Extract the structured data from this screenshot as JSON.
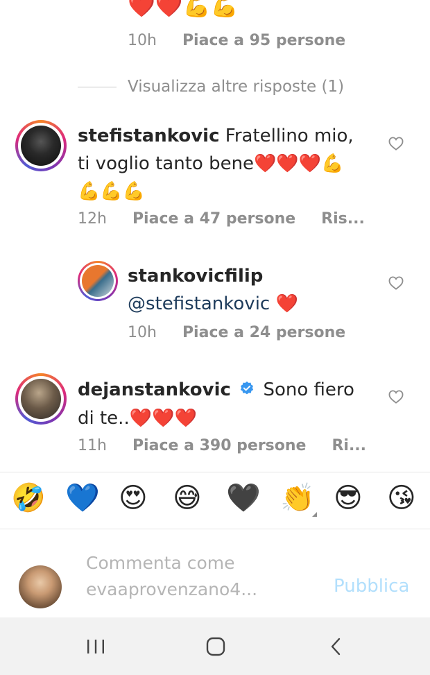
{
  "top_partial": {
    "emojis": "❤️❤️💪💪",
    "time": "10h",
    "likes": "Piace a 95 persone"
  },
  "view_more_replies": "Visualizza altre risposte (1)",
  "comments": [
    {
      "username": "stefistankovic",
      "text_line1": "Fratellino mio,",
      "text_line2": "ti voglio tanto bene❤️❤️❤️💪",
      "text_line3": "💪💪💪",
      "time": "12h",
      "likes": "Piace a 47 persone",
      "reply": "Ris..."
    },
    {
      "username": "stankovicfilip",
      "mention": "@stefistankovic",
      "heart": "❤️",
      "time": "10h",
      "likes": "Piace a 24 persone"
    },
    {
      "username": "dejanstankovic",
      "text_line1": "Sono fiero",
      "text_line2": "di te..❤️❤️❤️",
      "time": "11h",
      "likes": "Piace a 390 persone",
      "reply": "Ri..."
    }
  ],
  "emoji_bar": [
    "🤣",
    "💙",
    "😍",
    "😅",
    "🖤",
    "👏",
    "😎",
    "😘"
  ],
  "composer": {
    "placeholder_line1": "Commenta come",
    "placeholder_line2": "evaaprovenzano4...",
    "publish_label": "Pubblica"
  },
  "colors": {
    "link": "#1d3b5b",
    "verified": "#3897f0",
    "publish": "#b2dffc",
    "meta": "#8e8e8e"
  },
  "icons": {
    "like": "heart-outline-icon",
    "verified": "verified-badge-icon",
    "nav_recents": "recents-icon",
    "nav_home": "home-icon",
    "nav_back": "back-icon"
  }
}
